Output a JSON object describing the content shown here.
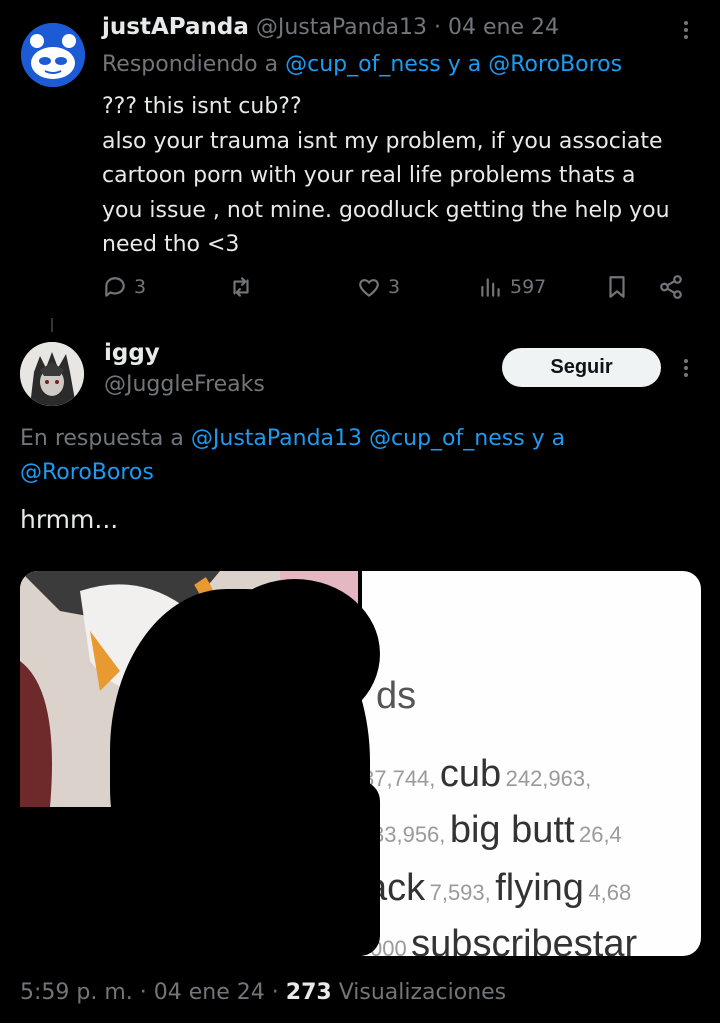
{
  "tweet1": {
    "display_name": "justAPanda",
    "handle": "@JustaPanda13",
    "separator": "·",
    "date": "04 ene 24",
    "reply_prefix": "Respondiendo a",
    "reply_user1": "@cup_of_ness",
    "reply_connector": "y a",
    "reply_user2": "@RoroBoros",
    "body_lines": [
      "??? this isnt cub??",
      "also your trauma isnt my problem, if you associate",
      "cartoon porn with your real life problems thats a",
      "you issue , not mine. goodluck getting the help you",
      "need tho <3"
    ],
    "replies": "3",
    "likes": "3",
    "views": "597"
  },
  "tweet2": {
    "display_name": "iggy",
    "handle": "@JuggleFreaks",
    "follow_label": "Seguir",
    "reply_prefix": "En respuesta a",
    "reply_user1": "@JustaPanda13",
    "reply_user2": "@cup_of_ness",
    "reply_connector": "y a",
    "reply_user3": "@RoroBoros",
    "body": "hrmm...",
    "media_text": {
      "heading_fragment": "ds",
      "row1_count_a": "37,744,",
      "row1_tag": "cub",
      "row1_count_b": "242,963,",
      "row2_count_a": "33,956,",
      "row2_tag": "big butt",
      "row2_count_b": "26,4",
      "row3_tag_a": "ack",
      "row3_count_a": "7,593,",
      "row3_tag_b": "flying",
      "row3_count_b": "4,68",
      "row4_count": "000",
      "row4_tag": "subscribestar"
    },
    "time": "5:59 p. m.",
    "separator": "·",
    "date": "04 ene 24",
    "views_count": "273",
    "views_label": "Visualizaciones"
  },
  "colors": {
    "background": "#000000",
    "text": "#e7e9ea",
    "muted": "#71767b",
    "link": "#1d9bf0",
    "follow_bg": "#eff3f4"
  }
}
